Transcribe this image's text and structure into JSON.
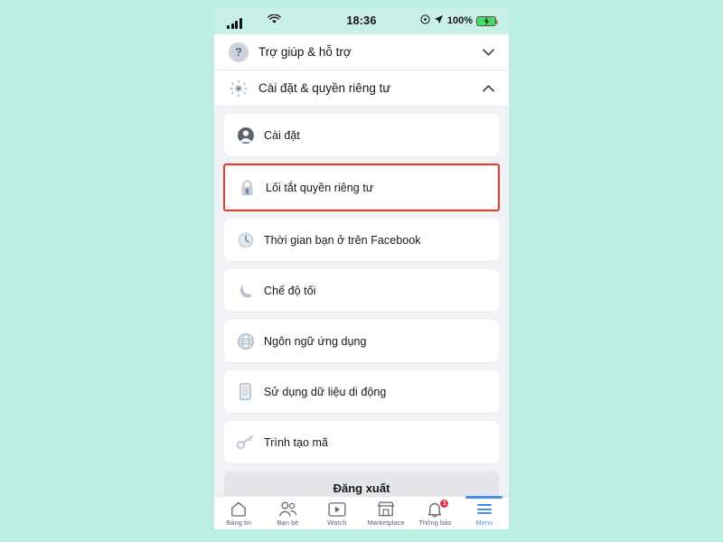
{
  "page": {
    "background_color": "#bdeee4"
  },
  "status_bar": {
    "signal_icon": "cellular-signal-icon",
    "wifi_icon": "wifi-icon",
    "time": "18:36",
    "alarm_icon": "alarm-icon",
    "location_icon": "location-arrow-icon",
    "battery_percent": "100%",
    "battery_icon": "battery-charging-icon",
    "battery_color": "#4cd964"
  },
  "sections": [
    {
      "id": "help-support",
      "icon": "question-mark-circle-icon",
      "label": "Trợ giúp & hỗ trợ",
      "chevron": "chevron-down-icon",
      "chevron_glyph": "⌄",
      "expanded": false
    },
    {
      "id": "settings-privacy",
      "icon": "gear-icon",
      "label": "Cài đặt & quyền riêng tư",
      "chevron": "chevron-up-icon",
      "chevron_glyph": "⌃",
      "expanded": true
    }
  ],
  "menu_items": [
    {
      "id": "settings",
      "icon": "avatar-person-icon",
      "label": "Cài đặt",
      "highlighted": false
    },
    {
      "id": "privacy-shortcut",
      "icon": "lock-icon",
      "label": "Lối tắt quyền riêng tư",
      "highlighted": true
    },
    {
      "id": "time-on-facebook",
      "icon": "clock-icon",
      "label": "Thời gian bạn ở trên Facebook",
      "highlighted": false
    },
    {
      "id": "dark-mode",
      "icon": "moon-icon",
      "label": "Chế độ tối",
      "highlighted": false
    },
    {
      "id": "app-language",
      "icon": "globe-icon",
      "label": "Ngôn ngữ ứng dụng",
      "highlighted": false
    },
    {
      "id": "mobile-data",
      "icon": "mobile-phone-icon",
      "label": "Sử dụng dữ liệu di động",
      "highlighted": false
    },
    {
      "id": "code-generator",
      "icon": "key-icon",
      "label": "Trình tạo mã",
      "highlighted": false
    }
  ],
  "highlight": {
    "color": "#e8392c",
    "target_item": "privacy-shortcut"
  },
  "logout": {
    "label": "Đăng xuất"
  },
  "tabbar": {
    "active_color": "#4a90e8",
    "tabs": [
      {
        "id": "news-feed",
        "icon": "home-icon",
        "label": "Bảng tin",
        "active": false,
        "badge": null
      },
      {
        "id": "friends",
        "icon": "friends-icon",
        "label": "Bạn bè",
        "active": false,
        "badge": null
      },
      {
        "id": "watch",
        "icon": "video-play-icon",
        "label": "Watch",
        "active": false,
        "badge": null
      },
      {
        "id": "marketplace",
        "icon": "storefront-icon",
        "label": "Marketplace",
        "active": false,
        "badge": null
      },
      {
        "id": "notifications",
        "icon": "bell-icon",
        "label": "Thông báo",
        "active": false,
        "badge": "1"
      },
      {
        "id": "menu",
        "icon": "hamburger-menu-icon",
        "label": "Menu",
        "active": true,
        "badge": null
      }
    ]
  }
}
